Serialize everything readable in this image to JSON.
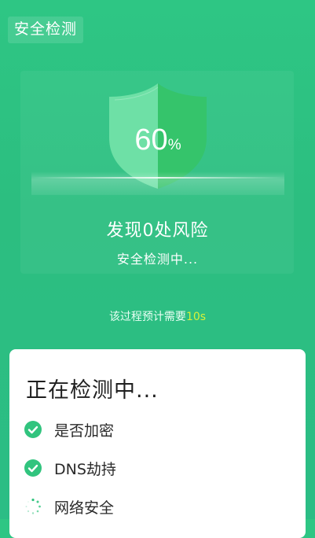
{
  "header": {
    "title": "安全检测"
  },
  "scan": {
    "progress": 60,
    "progress_value": "60",
    "progress_unit": "%",
    "risk_text": "发现0处风险",
    "status_text": "安全检测中...",
    "eta_prefix": "该过程预计需要",
    "eta_value": "10s"
  },
  "card": {
    "title": "正在检测中...",
    "items": [
      {
        "label": "是否加密",
        "state": "done",
        "icon": "check-circle-icon"
      },
      {
        "label": "DNS劫持",
        "state": "done",
        "icon": "check-circle-icon"
      },
      {
        "label": "网络安全",
        "state": "loading",
        "icon": "spinner-icon"
      }
    ]
  },
  "colors": {
    "background": "#2ec684",
    "shield_left": "#6ee0a6",
    "shield_right": "#35c46b",
    "accent_check": "#31c47e",
    "eta_highlight": "#d6f23a"
  }
}
